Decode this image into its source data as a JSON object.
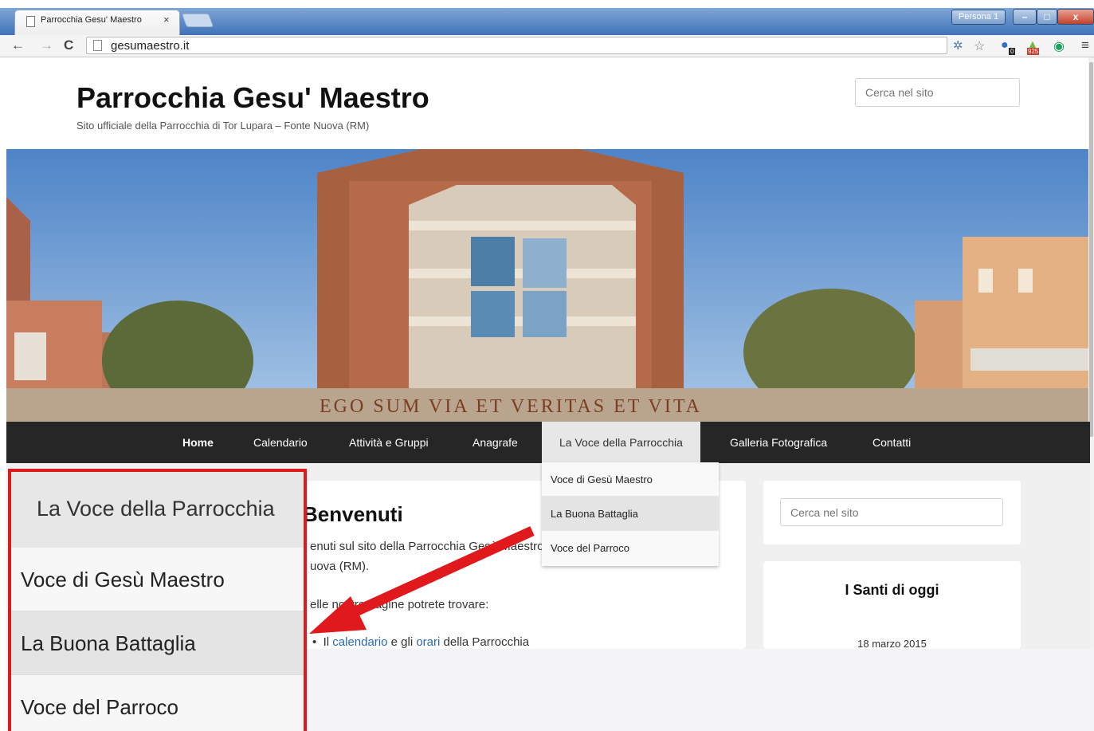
{
  "browser": {
    "tab_title": "Parrocchia Gesu' Maestro",
    "tab_close": "×",
    "profile": "Persona 1",
    "url": "gesumaestro.it",
    "back": "←",
    "forward": "→",
    "reload": "C",
    "menu": "≡",
    "badges": {
      "ext2": "0",
      "ext3": "925"
    }
  },
  "header": {
    "site_title": "Parrocchia Gesu' Maestro",
    "tagline": "Sito ufficiale della Parrocchia di Tor Lupara – Fonte Nuova (RM)",
    "search_placeholder": "Cerca nel sito"
  },
  "hero": {
    "inscription": "EGO SUM VIA ET VERITAS ET VITA"
  },
  "nav": {
    "items": [
      {
        "label": "Home"
      },
      {
        "label": "Calendario"
      },
      {
        "label": "Attività e Gruppi"
      },
      {
        "label": "Anagrafe"
      },
      {
        "label": "La Voce della Parrocchia"
      },
      {
        "label": "Galleria Fotografica"
      },
      {
        "label": "Contatti"
      }
    ],
    "dropdown": [
      {
        "label": "Voce di Gesù Maestro"
      },
      {
        "label": "La Buona Battaglia"
      },
      {
        "label": "Voce del Parroco"
      }
    ]
  },
  "main": {
    "title": "Benvenuti",
    "p1_line1": "enuti sul sito della Parrocchia Gesù Maestro",
    "p1_line2": "uova (RM).",
    "p2": "elle nostre pagine potrete trovare:",
    "bullet_pre": "Il ",
    "bullet_link1": "calendario",
    "bullet_mid": " e gli ",
    "bullet_link2": "orari",
    "bullet_post": " della Parrocchia"
  },
  "sidebar": {
    "search_placeholder": "Cerca nel sito",
    "santi_title": "I Santi di oggi",
    "santi_date": "18 marzo 2015"
  },
  "zoom": {
    "header": "La Voce della Parrocchia",
    "items": [
      {
        "label": "Voce di Gesù Maestro"
      },
      {
        "label": "La Buona Battaglia"
      },
      {
        "label": "Voce del Parroco"
      }
    ]
  },
  "colors": {
    "nav_bg": "#262626",
    "callout_red": "#e0191c",
    "link": "#2a6ab5"
  }
}
